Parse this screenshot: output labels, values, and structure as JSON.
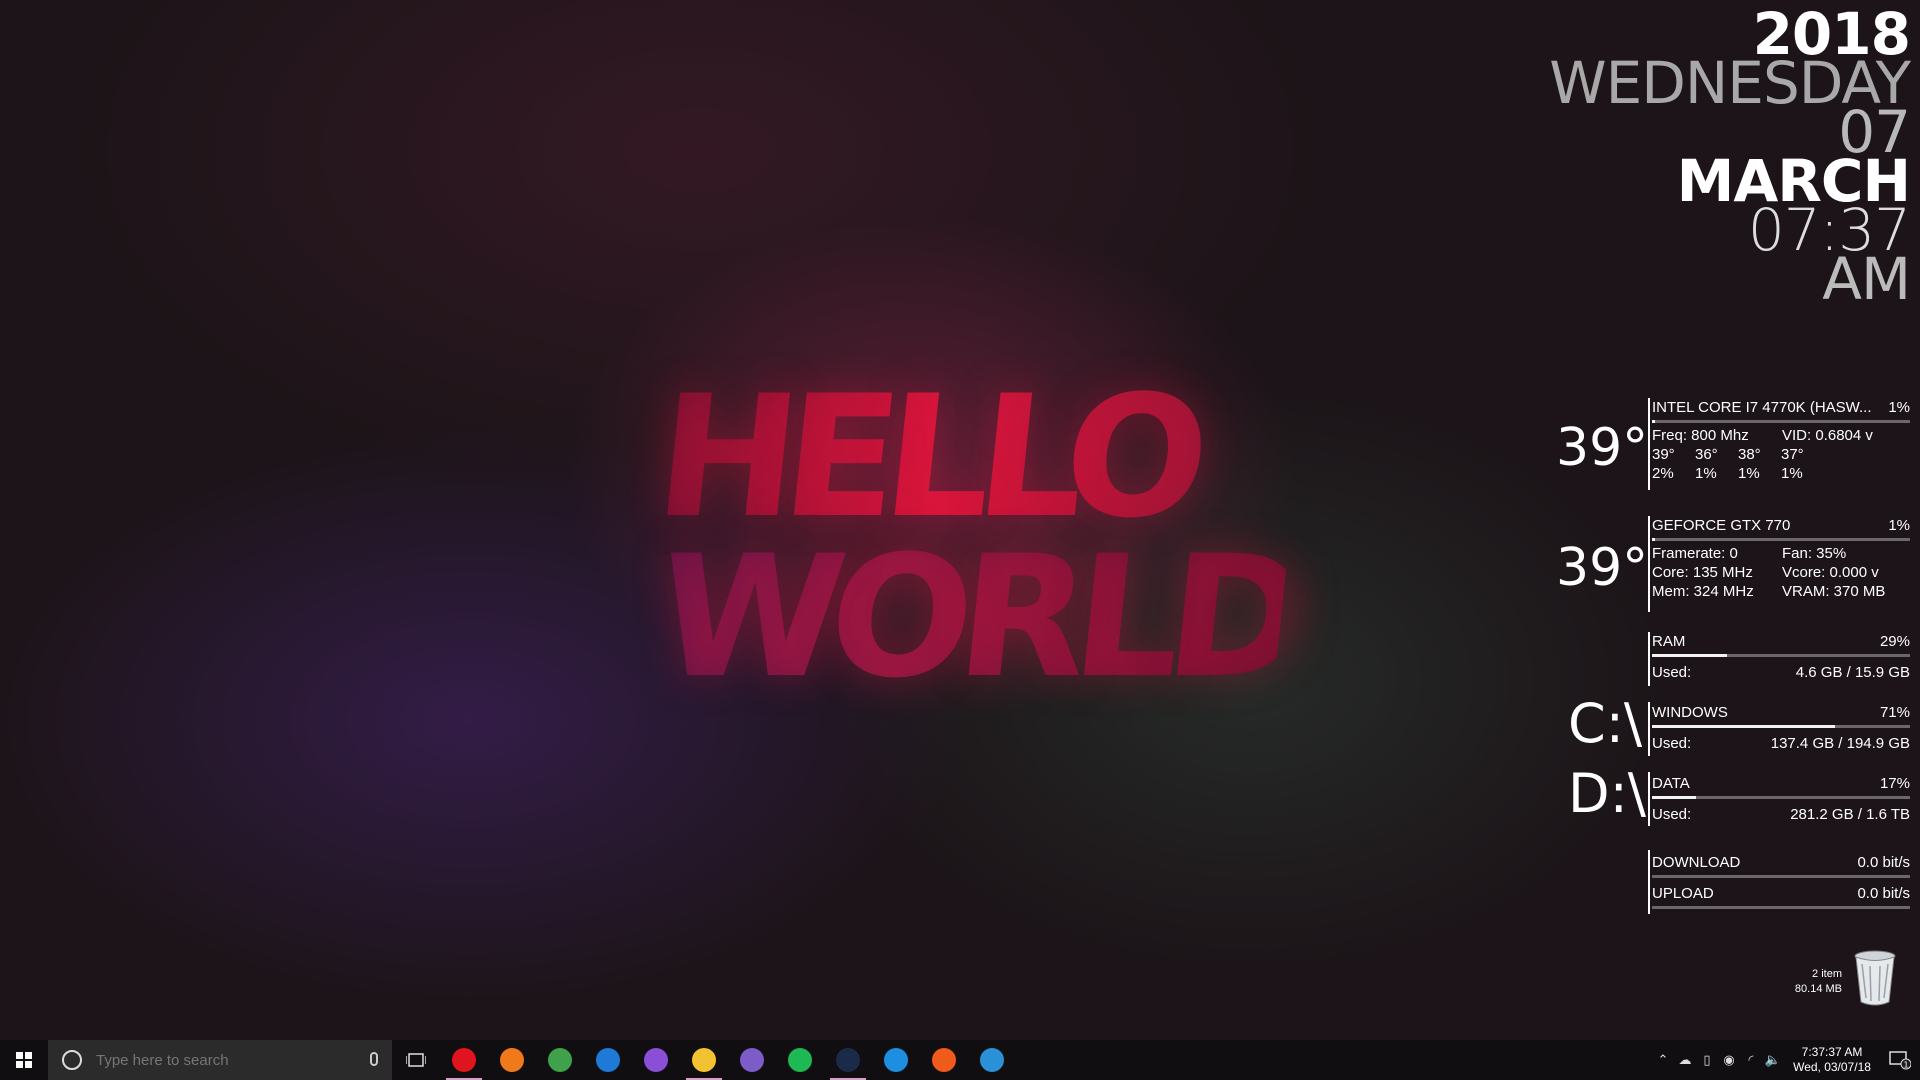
{
  "wallpaper": {
    "line1": "HELLO",
    "line2": "WORLD"
  },
  "clock": {
    "year": "2018",
    "weekday": "WEDNESDAY",
    "day": "07",
    "month": "MARCH",
    "time": "07:37",
    "ampm": "AM"
  },
  "cpu": {
    "temp": "39°",
    "name": "INTEL CORE I7 4770K (HASW...",
    "usage": "1%",
    "usage_value": 1,
    "freq": "Freq: 800 Mhz",
    "vid": "VID: 0.6804 v",
    "core_temps": [
      "39°",
      "36°",
      "38°",
      "37°"
    ],
    "core_loads": [
      "2%",
      "1%",
      "1%",
      "1%"
    ]
  },
  "gpu": {
    "temp": "39°",
    "name": "GEFORCE GTX 770",
    "usage": "1%",
    "usage_value": 1,
    "framerate": "Framerate: 0",
    "fan": "Fan: 35%",
    "core": "Core: 135 MHz",
    "vcore": "Vcore: 0.000 v",
    "mem": "Mem: 324 MHz",
    "vram": "VRAM: 370 MB"
  },
  "ram": {
    "label": "RAM",
    "usage": "29%",
    "usage_value": 29,
    "used_label": "Used:",
    "used": "4.6 GB / 15.9 GB"
  },
  "drive_c": {
    "letter": "C:\\",
    "label": "WINDOWS",
    "usage": "71%",
    "usage_value": 71,
    "used_label": "Used:",
    "used": "137.4 GB / 194.9 GB"
  },
  "drive_d": {
    "letter": "D:\\",
    "label": "DATA",
    "usage": "17%",
    "usage_value": 17,
    "used_label": "Used:",
    "used": "281.2 GB / 1.6 TB"
  },
  "network": {
    "download_label": "DOWNLOAD",
    "download": "0.0 bit/s",
    "upload_label": "UPLOAD",
    "upload": "0.0 bit/s"
  },
  "recycle_bin": {
    "items": "2 item",
    "size": "80.14 MB"
  },
  "taskbar": {
    "search_placeholder": "Type here to search",
    "apps": [
      {
        "name": "opera-icon",
        "color": "#e0141e"
      },
      {
        "name": "firefox-icon",
        "color": "#f07a1a"
      },
      {
        "name": "chrome-icon",
        "color": "#3fa14a"
      },
      {
        "name": "edge-icon",
        "color": "#1e7ad6"
      },
      {
        "name": "onenote-icon",
        "color": "#8a4fd6"
      },
      {
        "name": "file-explorer-icon",
        "color": "#f2c230"
      },
      {
        "name": "viber-icon",
        "color": "#7b5cc8"
      },
      {
        "name": "spotify-icon",
        "color": "#1db954"
      },
      {
        "name": "steam-icon",
        "color": "#1b2a48"
      },
      {
        "name": "battle-net-icon",
        "color": "#1d8fe0"
      },
      {
        "name": "origin-icon",
        "color": "#f05a1a"
      },
      {
        "name": "uplay-icon",
        "color": "#2a90d8"
      }
    ],
    "tray_time": "7:37:37 AM",
    "tray_date": "Wed, 03/07/18",
    "notification_count": "1"
  }
}
